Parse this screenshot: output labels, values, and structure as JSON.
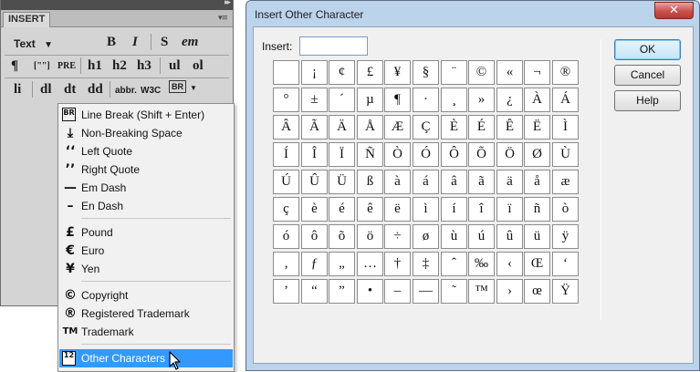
{
  "panel": {
    "tab_label": "INSERT",
    "toolbar": {
      "text_dropdown": "Text",
      "bold": "B",
      "italic": "I",
      "strong": "S",
      "em": "em",
      "paragraph": "¶",
      "blockquote": "[\"\"]",
      "pre": "PRE",
      "h1": "h1",
      "h2": "h2",
      "h3": "h3",
      "ul": "ul",
      "ol": "ol",
      "li": "li",
      "dl": "dl",
      "dt": "dt",
      "dd": "dd",
      "abbr": "abbr.",
      "w3c": "W3C",
      "characters_icon": "BR"
    }
  },
  "menu": {
    "items": [
      {
        "icon": "BR",
        "label": "Line Break (Shift + Enter)",
        "icon_name": "line-break-icon"
      },
      {
        "icon": "⤓",
        "label": "Non-Breaking Space",
        "icon_name": "nbsp-icon"
      },
      {
        "icon": "‘‘",
        "label": "Left Quote",
        "icon_name": "left-quote-icon"
      },
      {
        "icon": "’’",
        "label": "Right Quote",
        "icon_name": "right-quote-icon"
      },
      {
        "icon": "—",
        "label": "Em Dash",
        "icon_name": "em-dash-icon"
      },
      {
        "icon": "–",
        "label": "En Dash",
        "icon_name": "en-dash-icon"
      },
      {
        "icon": "£",
        "label": "Pound",
        "icon_name": "pound-icon"
      },
      {
        "icon": "€",
        "label": "Euro",
        "icon_name": "euro-icon"
      },
      {
        "icon": "¥",
        "label": "Yen",
        "icon_name": "yen-icon"
      },
      {
        "icon": "©",
        "label": "Copyright",
        "icon_name": "copyright-icon"
      },
      {
        "icon": "®",
        "label": "Registered Trademark",
        "icon_name": "registered-icon"
      },
      {
        "icon": "TM",
        "label": "Trademark",
        "icon_name": "trademark-icon"
      },
      {
        "icon": "12",
        "label": "Other Characters",
        "icon_name": "other-characters-icon",
        "selected": true
      }
    ]
  },
  "dialog": {
    "title": "Insert Other Character",
    "close_glyph": "✕",
    "insert_label": "Insert:",
    "insert_value": "",
    "buttons": {
      "ok": "OK",
      "cancel": "Cancel",
      "help": "Help"
    },
    "characters": [
      [
        "",
        "¡",
        "¢",
        "£",
        "¥",
        "§",
        "¨",
        "©",
        "«",
        "¬",
        "®"
      ],
      [
        "°",
        "±",
        "´",
        "µ",
        "¶",
        "·",
        "¸",
        "»",
        "¿",
        "À",
        "Á"
      ],
      [
        "Â",
        "Ã",
        "Ä",
        "Å",
        "Æ",
        "Ç",
        "È",
        "É",
        "Ê",
        "Ë",
        "Ì"
      ],
      [
        "Í",
        "Î",
        "Ï",
        "Ñ",
        "Ò",
        "Ó",
        "Ô",
        "Õ",
        "Ö",
        "Ø",
        "Ù"
      ],
      [
        "Ú",
        "Û",
        "Ü",
        "ß",
        "à",
        "á",
        "â",
        "ã",
        "ä",
        "å",
        "æ"
      ],
      [
        "ç",
        "è",
        "é",
        "ê",
        "ë",
        "ì",
        "í",
        "î",
        "ï",
        "ñ",
        "ò"
      ],
      [
        "ó",
        "ô",
        "õ",
        "ö",
        "÷",
        "ø",
        "ù",
        "ú",
        "û",
        "ü",
        "ÿ"
      ],
      [
        "‚",
        "ƒ",
        "„",
        "…",
        "†",
        "‡",
        "ˆ",
        "‰",
        "‹",
        "Œ",
        "‘"
      ],
      [
        "’",
        "“",
        "”",
        "•",
        "–",
        "—",
        "˜",
        "™",
        "›",
        "œ",
        "Ÿ"
      ]
    ]
  }
}
